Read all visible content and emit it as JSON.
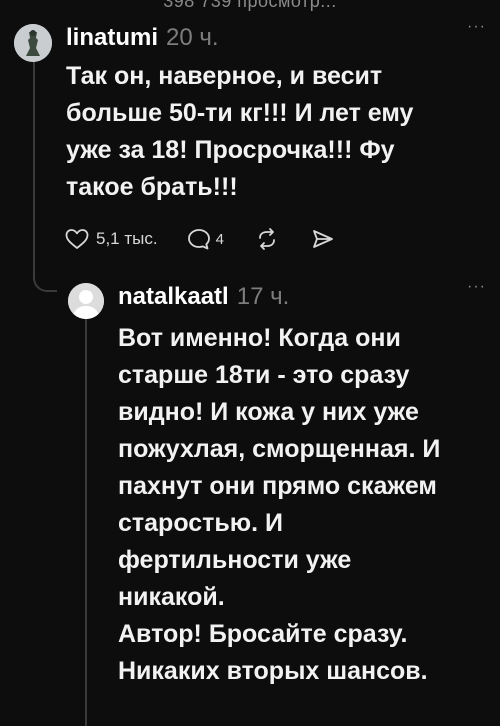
{
  "header": {
    "views_text": "398 739 просмотр..."
  },
  "comments": [
    {
      "author": "linatumi",
      "time": "20 ч.",
      "more": "···",
      "text": "Так он, наверное, и весит\nбольше 50-ти кг!!! И лет ему\nуже за 18! Просрочка!!! Фу\nтакое брать!!!",
      "likes": "5,1 тыс.",
      "replies": "4"
    },
    {
      "author": "natalkaatl",
      "time": "17 ч.",
      "more": "···",
      "text": "Вот именно! Когда они\nстарше 18ти - это сразу\nвидно! И кожа у них уже\nпожухлая, сморщенная. И\nпахнут они прямо скажем\nстаростью. И\nфертильности уже\nникакой.\nАвтор! Бросайте сразу.\nНикаких вторых шансов."
    }
  ]
}
